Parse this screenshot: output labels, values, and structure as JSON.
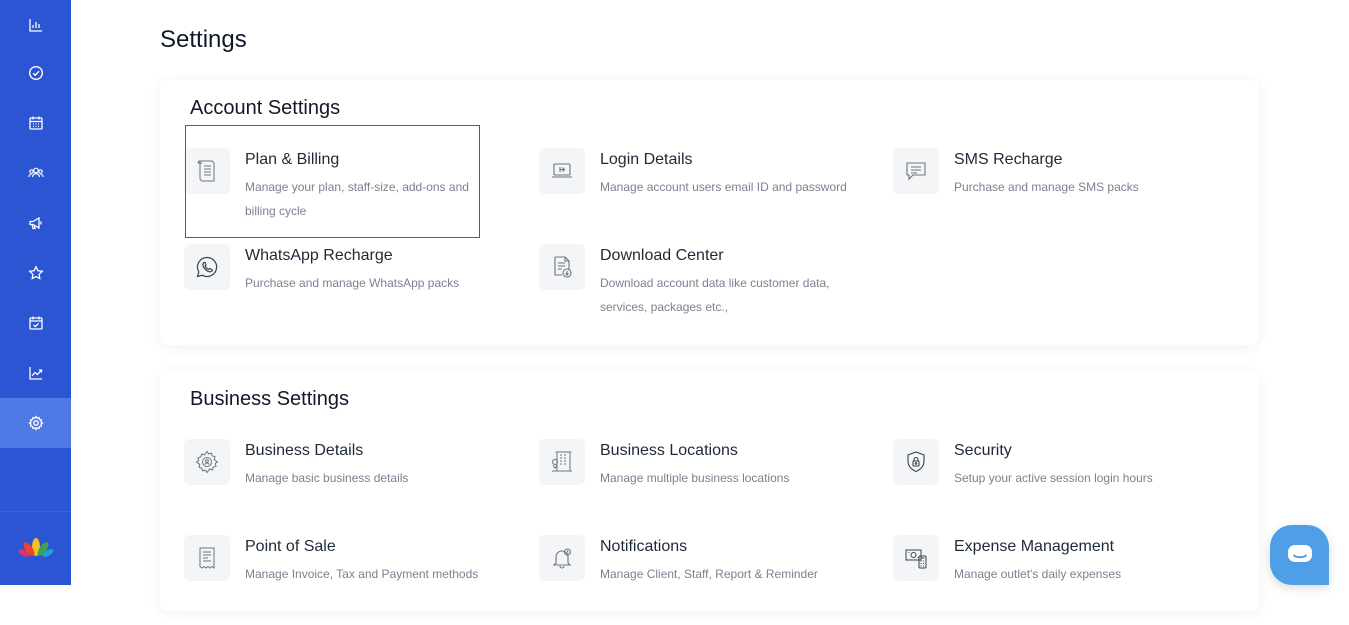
{
  "page": {
    "title": "Settings"
  },
  "sidebar": {
    "items": [
      {
        "icon": "bar-chart-icon"
      },
      {
        "icon": "check-circle-icon"
      },
      {
        "icon": "calendar-icon"
      },
      {
        "icon": "users-group-icon"
      },
      {
        "icon": "megaphone-icon"
      },
      {
        "icon": "star-icon"
      },
      {
        "icon": "calendar-check-icon"
      },
      {
        "icon": "trending-up-icon"
      },
      {
        "icon": "gear-icon",
        "active": true
      }
    ],
    "colors": {
      "background": "#2c55d3",
      "active": "#4f7ae6"
    }
  },
  "account_settings": {
    "title": "Account Settings",
    "items": [
      {
        "title": "Plan & Billing",
        "desc": "Manage your plan, staff-size, add-ons and billing cycle"
      },
      {
        "title": "Login Details",
        "desc": "Manage account users email ID and password"
      },
      {
        "title": "SMS Recharge",
        "desc": "Purchase and manage SMS packs"
      },
      {
        "title": "WhatsApp Recharge",
        "desc": "Purchase and manage WhatsApp packs"
      },
      {
        "title": "Download Center",
        "desc": "Download account data like customer data, services, packages etc.,"
      }
    ]
  },
  "business_settings": {
    "title": "Business Settings",
    "items": [
      {
        "title": "Business Details",
        "desc": "Manage basic business details"
      },
      {
        "title": "Business Locations",
        "desc": "Manage multiple business locations"
      },
      {
        "title": "Security",
        "desc": "Setup your active session login hours"
      },
      {
        "title": "Point of Sale",
        "desc": "Manage Invoice, Tax and Payment methods"
      },
      {
        "title": "Notifications",
        "desc": "Manage Client, Staff, Report & Reminder"
      },
      {
        "title": "Expense Management",
        "desc": "Manage outlet's daily expenses"
      }
    ]
  },
  "highlight_color": "#e0252b"
}
